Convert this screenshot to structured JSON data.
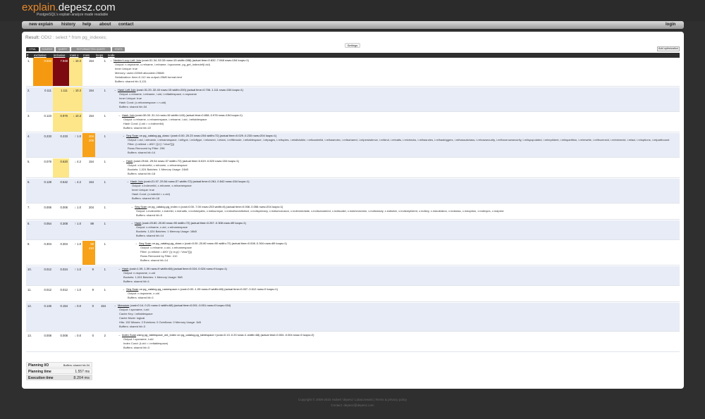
{
  "header": {
    "logo_a": "explain.",
    "logo_b": "depesz.com",
    "tagline": "PostgreSQL's explain analyze made readable"
  },
  "nav": {
    "items": [
      "new explain",
      "history",
      "help",
      "about",
      "contact"
    ],
    "login": "login"
  },
  "result": {
    "prefix": "Result:",
    "title": "ODt2 : select * from pg_indexes;"
  },
  "settings_label": "Settings",
  "tabs": [
    "HTML",
    "SOURCE",
    "QUERY",
    "REFORMATTED QUERY",
    "STATS"
  ],
  "add_optimization": "Add optimization",
  "columns": [
    "#",
    "exclusive",
    "inclusive",
    "rows x",
    "rows",
    "loops",
    "node"
  ],
  "rows": [
    {
      "n": "1.",
      "excl": "0.593",
      "incl": "7.948",
      "rx": "↓ 10.3",
      "rows": "154",
      "loops": "1",
      "indent": 0,
      "op": "Nested Loop Left Join",
      "extra": "(cost=31.34..53.33 rows=15 width=288) (actual time=0.832..7.948 rows=154 loops=1)",
      "details": [
        "Output: n.nspname, c.relname, i.relname, t.spcname, pg_get_indexdef(i.oid)",
        "Inner Unique: true",
        "Memory: used=220kB allocated=256kB",
        "Serialization: time=0.112 ms output=25kB format=text",
        "Buffers: shared hit=3,131"
      ],
      "exh": "hm",
      "inh": "hx",
      "rxh": "hl"
    },
    {
      "n": "2.",
      "excl": "0.111",
      "incl": "1.111",
      "rx": "↓ 10.3",
      "rows": "154",
      "loops": "1",
      "indent": 1,
      "op": "Hash Left Join",
      "extra": "(cost=31.20..32.40 rows=15 width=200) (actual time=0.706..1.111 rows=154 loops=1)",
      "details": [
        "Output: c.relname, i.relname, i.oid, i.reltablespace, n.nspname",
        "Inner Unique: true",
        "Hash Cond: (c.relnamespace = n.oid)",
        "Buffers: shared hit=34"
      ],
      "exh": "",
      "inh": "hl",
      "rxh": "hl"
    },
    {
      "n": "3.",
      "excl": "0.123",
      "incl": "0.976",
      "rx": "↓ 10.3",
      "rows": "154",
      "loops": "1",
      "indent": 2,
      "op": "Hash Join",
      "extra": "(cost=30.00..31.14 rows=15 width=140) (actual time=0.658..0.976 rows=154 loops=1)",
      "details": [
        "Output: c.relname, c.relnamespace, i.relname, i.oid, i.reltablespace",
        "Hash Cond: (i.oid = x.indexrelid)",
        "Buffers: shared hit=22"
      ],
      "exh": "",
      "inh": "hl",
      "rxh": "hl"
    },
    {
      "n": "4.",
      "excl": "0.233",
      "incl": "0.233",
      "rx": "↑ 1.0",
      "rows": "204",
      "loops": "1",
      "indent": 3,
      "op": "Seq Scan",
      "extra": "on pg_catalog.pg_class i (cost=0.00..20.23 rows=204 width=72) (actual time=0.029..0.233 rows=204 loops=1)",
      "details": [
        "Output: i.oid, i.relname, i.relnamespace, i.reltype, i.reloftype, i.relowner, i.relam, i.relfilenode, i.reltablespace, i.relpages, i.reltuples, i.relallvisible, i.reltoastrelid, i.relhasindex, i.relisshared, i.relpersistence, i.relkind, i.relnatts, i.relchecks, i.relhasrules, i.relhastriggers, i.relhassubclass, i.relrowsecurity, i.relforcerowsecurity, i.relispopulated, i.relreplident, i.relispartition, i.relrewrite, i.relfrozenxid, i.relminmxid, i.relacl, i.reloptions, i.relpartbound",
        "Filter: (i.relkind = ANY ('{i,I}'::\"char\"[]))",
        "Rows Removed by Filter: 298",
        "Buffers: shared hit=14"
      ],
      "exh": "",
      "inh": "",
      "rxh": "",
      "rh": "hlr",
      "rsub": "205"
    },
    {
      "n": "5.",
      "excl": "0.078",
      "incl": "0.620",
      "rx": "↓ 4.2",
      "rows": "154",
      "loops": "1",
      "indent": 3,
      "op": "Hash",
      "extra": "(cost=29.64..29.54 rows=37 width=72) (actual time=0.619..0.620 rows=154 loops=1)",
      "details": [
        "Output: x.indexrelid, c.relname, c.relnamespace",
        "Buckets: 1,024 Batches: 1 Memory Usage: 24kB",
        "Buffers: shared hit=18"
      ],
      "exh": "",
      "inh": "hl",
      "rxh": ""
    },
    {
      "n": "6.",
      "excl": "0.128",
      "incl": "0.542",
      "rx": "↓ 4.2",
      "rows": "154",
      "loops": "1",
      "indent": 4,
      "op": "Hash Join",
      "extra": "(cost=21.97..29.54 rows=37 width=72) (actual time=0.261..0.542 rows=154 loops=1)",
      "details": [
        "Output: x.indexrelid, c.relname, c.relnamespace",
        "Inner Unique: true",
        "Hash Cond: (x.indrelid = c.oid)",
        "Buffers: shared hit=18"
      ],
      "exh": "",
      "inh": "",
      "rxh": ""
    },
    {
      "n": "7.",
      "excl": "0.006",
      "incl": "0.006",
      "rx": "↓ 1.0",
      "rows": "204",
      "loops": "1",
      "indent": 5,
      "op": "Seq Scan",
      "extra": "on pg_catalog.pg_index x (cost=0.00..7.00 rows=203 width=8) (actual time=0.008..0.056 rows=204 loops=1)",
      "details": [
        "Output: x.indexrelid, x.indrelid, x.indnatts, x.indnkeyatts, x.indisunique, x.indnullsnotdistinct, x.indisprimary, x.indisexclusion, x.indimmediate, x.indisclustered, x.indisvalid, x.indcheckxmin, x.indisready, x.indislive, x.indisreplident, x.indkey, x.indcollation, x.indclass, x.indoption, x.indexprs, x.indpred",
        "Buffers: shared hit=5"
      ],
      "exh": "",
      "inh": "",
      "rxh": ""
    },
    {
      "n": "8.",
      "excl": "0.054",
      "incl": "0.308",
      "rx": "↑ 1.0",
      "rows": "89",
      "loops": "1",
      "indent": 5,
      "op": "Hash",
      "extra": "(cost=20.80..20.80 rows=90 width=72) (actual time=0.257..0.308 rows=89 loops=1)",
      "details": [
        "Output: c.relname, c.oid, c.relnamespace",
        "Buckets: 1,024 Batches: 1 Memory Usage: 18kB",
        "Buffers: shared hit=14"
      ],
      "exh": "",
      "inh": "",
      "rxh": ""
    },
    {
      "n": "9.",
      "excl": "0.304",
      "incl": "0.304",
      "rx": "↑ 1.0",
      "rows": "89",
      "loops": "1",
      "indent": 6,
      "op": "Seq Scan",
      "extra": "on pg_catalog.pg_class c (cost=0.00..20.80 rows=90 width=72) (actual time=0.008..0.304 rows=89 loops=1)",
      "details": [
        "Output: c.relname, c.oid, c.relnamespace",
        "Filter: (c.relkind = ANY ('{r,m,p}'::\"char\"[]))",
        "Rows Removed by Filter: 410",
        "Buffers: shared hit=14"
      ],
      "exh": "",
      "inh": "",
      "rxh": "",
      "rh": "hlr",
      "rsub": "410"
    },
    {
      "n": "10.",
      "excl": "0.012",
      "incl": "0.024",
      "rx": "↑ 1.0",
      "rows": "9",
      "loops": "1",
      "indent": 2,
      "op": "Hash",
      "extra": "(cost=1.09..1.09 rows=9 width=68) (actual time=0.024..0.024 rows=9 loops=1)",
      "details": [
        "Output: n.nspname, n.oid",
        "Buckets: 1,024 Batches: 1 Memory Usage: 9kB",
        "Buffers: shared hit=1"
      ],
      "exh": "",
      "inh": "",
      "rxh": ""
    },
    {
      "n": "11.",
      "excl": "0.012",
      "incl": "0.012",
      "rx": "↑ 1.0",
      "rows": "9",
      "loops": "1",
      "indent": 3,
      "op": "Seq Scan",
      "extra": "on pg_catalog.pg_namespace n (cost=0.00..1.09 rows=9 width=68) (actual time=0.007..0.012 rows=9 loops=1)",
      "details": [
        "Output: n.nspname, n.oid",
        "Buffers: shared hit=1"
      ],
      "exh": "",
      "inh": "",
      "rxh": ""
    },
    {
      "n": "12.",
      "excl": "0.146",
      "incl": "0.154",
      "rx": "↓ 0.0",
      "rows": "0",
      "loops": "154",
      "indent": 1,
      "op": "Memoize",
      "extra": "(cost=0.14..0.21 rows=1 width=68) (actual time=0.001..0.001 rows=0 loops=154)",
      "details": [
        "Output: t.spcname, t.oid",
        "Cache Key: i.reltablespace",
        "Cache Mode: logical",
        "Hits: 152 Misses: 2 Evictions: 0 Overflows: 0 Memory Usage: 1kB",
        "Buffers: shared hit=3"
      ],
      "exh": "",
      "inh": "",
      "rxh": ""
    },
    {
      "n": "13.",
      "excl": "0.008",
      "incl": "0.008",
      "rx": "↓ 0.0",
      "rows": "0",
      "loops": "2",
      "indent": 2,
      "op": "Index Scan",
      "extra": "using pg_tablespace_oid_index on pg_catalog.pg_tablespace t (cost=0.13..0.20 rows=1 width=68) (actual time=0.004..0.004 rows=0 loops=2)",
      "details": [
        "Output: t.spcname, t.oid",
        "Index Cond: (t.oid = i.reltablespace)",
        "Buffers: shared hit=3"
      ],
      "exh": "",
      "inh": "",
      "rxh": ""
    }
  ],
  "summary": [
    {
      "k": "Planning I/O",
      "v": "Buffers: shared hit=34"
    },
    {
      "k": "Planning time",
      "v": "1.557 ms"
    },
    {
      "k": "Execution time",
      "v": "8.204 ms"
    }
  ],
  "footer": {
    "line1": "Copyright © 2008-2024 Hubert 'depesz' Lubaczewski | Terms & privacy policy",
    "line2": "Contact: depesz@depesz.com"
  }
}
